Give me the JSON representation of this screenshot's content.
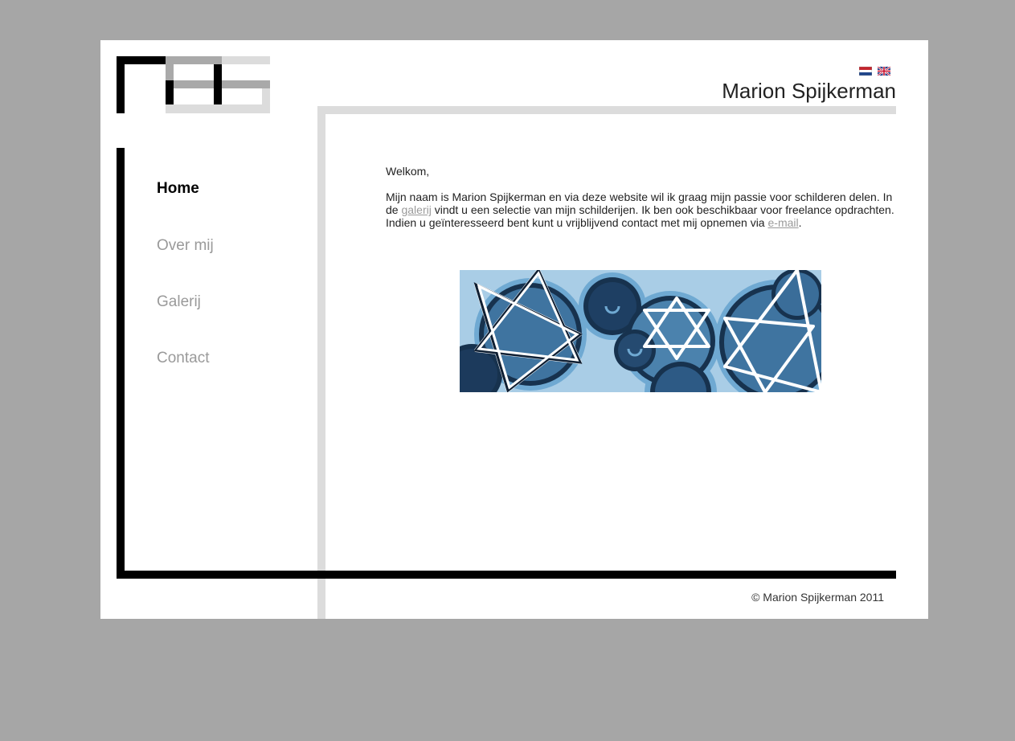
{
  "header": {
    "site_title": "Marion Spijkerman",
    "languages": [
      {
        "name": "Nederlands",
        "icon": "dutch-flag-icon"
      },
      {
        "name": "English",
        "icon": "uk-flag-icon"
      }
    ]
  },
  "nav": {
    "items": [
      {
        "label": "Home",
        "active": true
      },
      {
        "label": "Over mij",
        "active": false
      },
      {
        "label": "Galerij",
        "active": false
      },
      {
        "label": "Contact",
        "active": false
      }
    ]
  },
  "content": {
    "greeting": "Welkom,",
    "intro_part1": "Mijn naam is Marion Spijkerman en via deze website wil ik graag mijn passie voor schilderen delen. In de ",
    "gallery_link": "galerij",
    "intro_part2": " vindt u een selectie van mijn schilderijen. Ik ben ook beschikbaar voor freelance opdrachten. Indien u geïnteresseerd bent kunt u vrijblijvend contact met mij opnemen via ",
    "email_link": "e-mail",
    "intro_end": "."
  },
  "footer": {
    "copyright": "© Marion Spijkerman 2011"
  },
  "colors": {
    "background": "#a6a6a6",
    "nav_inactive": "#9a9a9a",
    "frame_dark": "#000000",
    "frame_light": "#dcdcdc"
  }
}
